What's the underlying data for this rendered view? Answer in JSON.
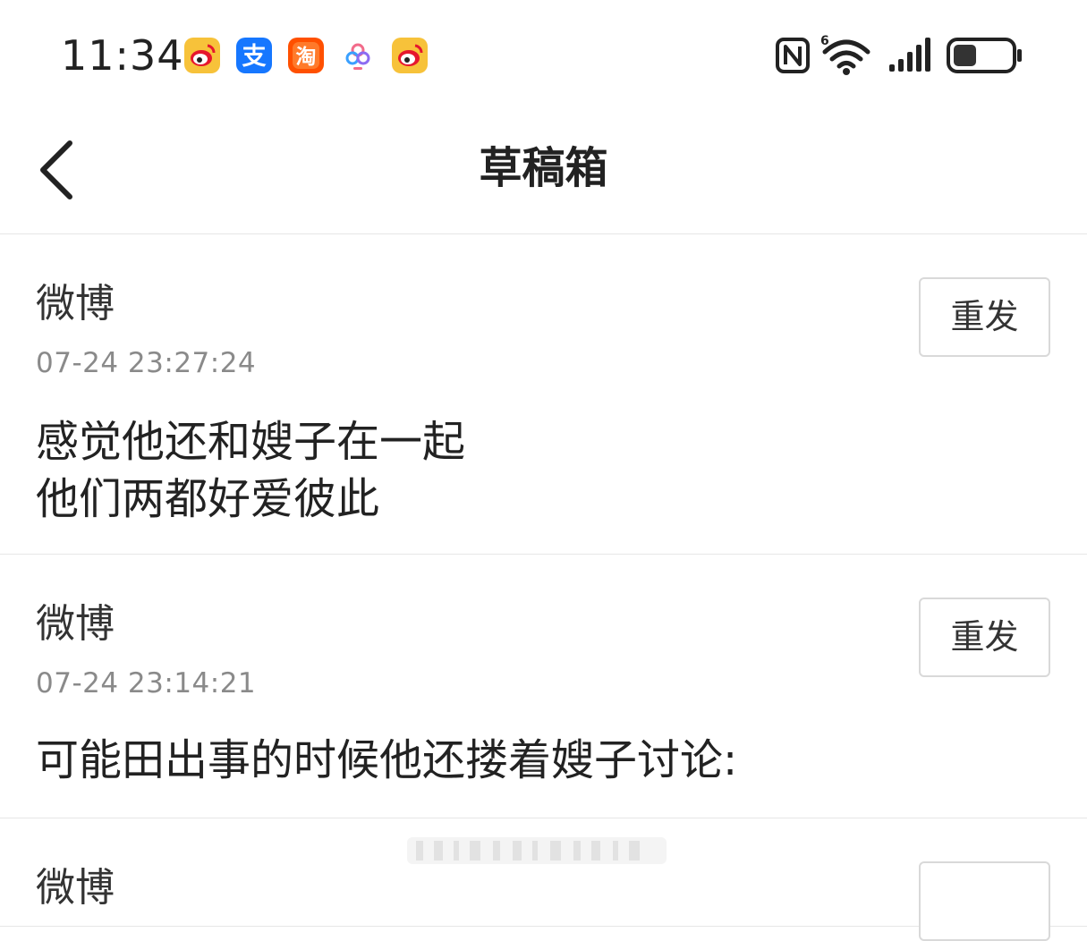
{
  "status_bar": {
    "time": "11:34",
    "notification_icons": [
      "weibo-icon",
      "alipay-icon",
      "taobao-icon",
      "camera-app-icon",
      "weibo-icon"
    ],
    "alipay_glyph": "支",
    "taobao_glyph": "淘",
    "wifi_badge": "6",
    "system_icons": [
      "nfc-icon",
      "wifi-icon",
      "signal-icon",
      "battery-icon"
    ],
    "battery_level": 0.4
  },
  "nav": {
    "title": "草稿箱",
    "back_icon": "chevron-left-icon"
  },
  "drafts": [
    {
      "source": "微博",
      "time": "07-24 23:27:24",
      "lines": [
        "感觉他还和嫂子在一起",
        "他们两都好爱彼此"
      ],
      "button_label": "重发"
    },
    {
      "source": "微博",
      "time": "07-24 23:14:21",
      "lines": [
        "可能田出事的时候他还搂着嫂子讨论:"
      ],
      "button_label": "重发"
    },
    {
      "source": "微博"
    }
  ],
  "colors": {
    "weibo_yellow": "#f7c23a",
    "weibo_red": "#e6162d",
    "alipay_blue": "#1677ff",
    "taobao_orange": "#ff5000",
    "divider": "#e6e6e6",
    "time_gray": "#8a8a8a"
  }
}
